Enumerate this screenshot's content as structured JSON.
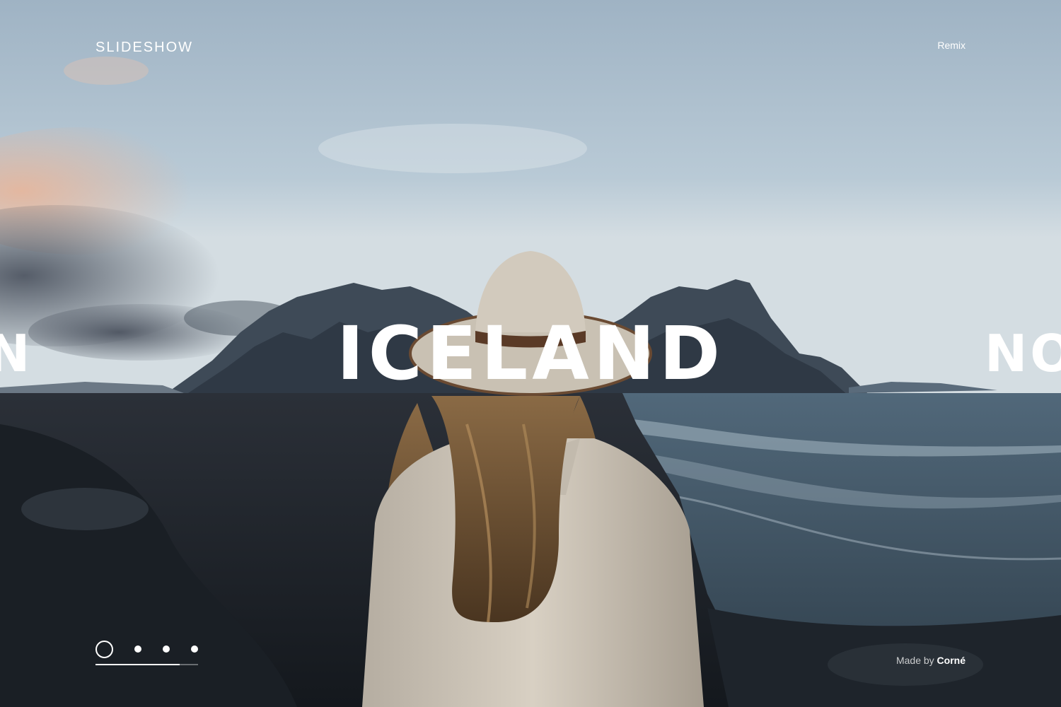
{
  "header": {
    "brand": "SLIDESHOW",
    "remix_label": "Remix"
  },
  "slides": {
    "current_title": "ICELAND",
    "previous_title_visible": "N",
    "next_title_visible": "NO"
  },
  "pager": {
    "count": 4,
    "active_index": 0,
    "progress_fraction": 0.82
  },
  "credit": {
    "prefix": "Made by",
    "author": "Corné"
  },
  "colors": {
    "text": "#ffffff",
    "sky_top": "#a8bccb",
    "sea": "#5f7585",
    "sand": "#1c2229",
    "coat": "#cdc5b8"
  },
  "image": {
    "description_icon": "hero-photo-woman-hat-icelandic-beach"
  }
}
